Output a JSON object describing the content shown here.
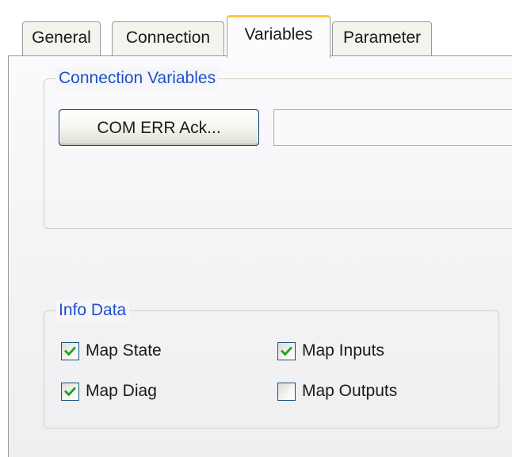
{
  "tabs": [
    {
      "label": "General",
      "selected": false
    },
    {
      "label": "Connection",
      "selected": false
    },
    {
      "label": "Variables",
      "selected": true
    },
    {
      "label": "Parameter",
      "selected": false
    }
  ],
  "connection_variables": {
    "title": "Connection Variables",
    "button_label": "COM ERR Ack...",
    "field_value": ""
  },
  "info_data": {
    "title": "Info Data",
    "checkboxes": [
      {
        "label": "Map State",
        "checked": true
      },
      {
        "label": "Map Inputs",
        "checked": true
      },
      {
        "label": "Map Diag",
        "checked": true
      },
      {
        "label": "Map Outputs",
        "checked": false
      }
    ]
  },
  "colors": {
    "group_title": "#1e50c8",
    "active_tab_highlight": "#ffc83c",
    "checkmark": "#21a121",
    "button_border": "#003c74"
  },
  "icons": {
    "checked": "checkmark-icon"
  }
}
